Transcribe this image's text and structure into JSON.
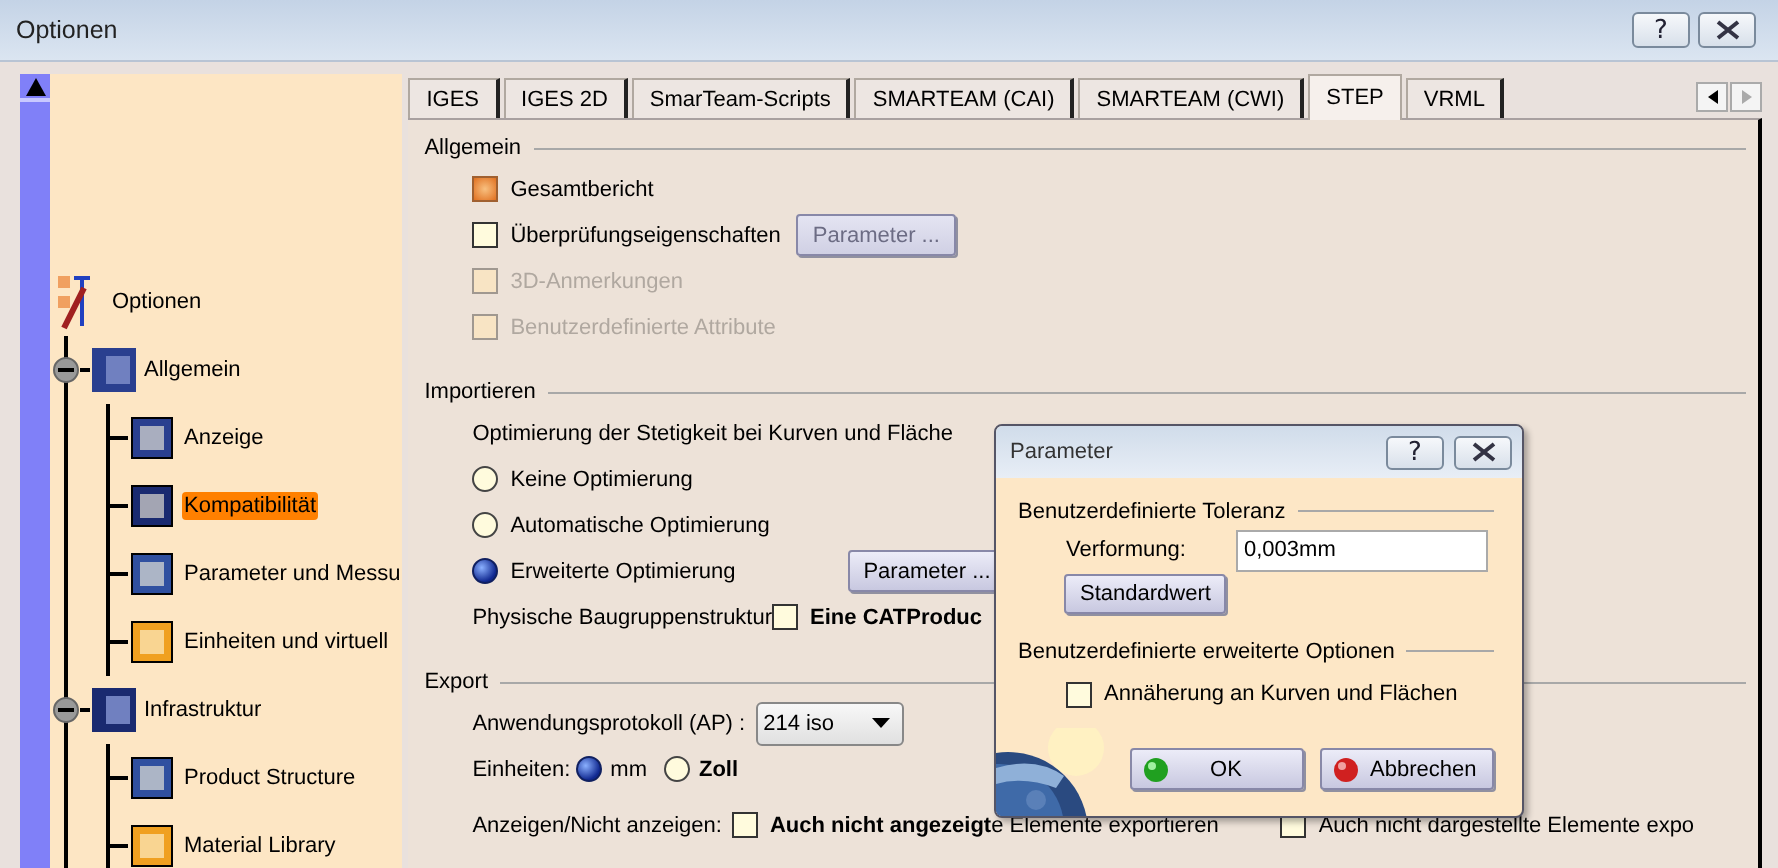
{
  "window": {
    "title": "Optionen",
    "help": "?"
  },
  "tree": [
    {
      "label": "Optionen",
      "selected": false,
      "children": [
        {
          "label": "Allgemein",
          "selected": false,
          "expanded": true,
          "children": [
            {
              "label": "Anzeige",
              "selected": false
            },
            {
              "label": "Kompatibilität",
              "selected": true
            },
            {
              "label": "Parameter und Messu",
              "selected": false
            },
            {
              "label": "Einheiten und virtuell",
              "selected": false
            }
          ]
        },
        {
          "label": "Infrastruktur",
          "selected": false,
          "expanded": true,
          "children": [
            {
              "label": "Product Structure",
              "selected": false
            },
            {
              "label": "Material Library",
              "selected": false
            }
          ]
        }
      ]
    }
  ],
  "tabs": [
    {
      "label": "IGES",
      "selected": false
    },
    {
      "label": "IGES 2D",
      "selected": false
    },
    {
      "label": "SmarTeam-Scripts",
      "selected": false
    },
    {
      "label": "SMARTEAM (CAI)",
      "selected": false
    },
    {
      "label": "SMARTEAM (CWI)",
      "selected": false
    },
    {
      "label": "STEP",
      "selected": true
    },
    {
      "label": "VRML",
      "selected": false
    }
  ],
  "general": {
    "title": "Allgemein",
    "options": [
      {
        "label": "Gesamtbericht",
        "checked": true,
        "disabled": false
      },
      {
        "label": "Überprüfungseigenschaften",
        "checked": false,
        "disabled": false,
        "button": {
          "label": "Parameter ...",
          "disabled": true
        }
      },
      {
        "label": "3D-Anmerkungen",
        "checked": false,
        "disabled": true
      },
      {
        "label": "Benutzerdefinierte Attribute",
        "checked": false,
        "disabled": true
      }
    ]
  },
  "import": {
    "title": "Importieren",
    "optimization_label": "Optimierung der Stetigkeit bei Kurven und Fläche",
    "radios": [
      {
        "label": "Keine Optimierung",
        "selected": false
      },
      {
        "label": "Automatische Optimierung",
        "selected": false
      },
      {
        "label": "Erweiterte Optimierung",
        "selected": true,
        "button": {
          "label": "Parameter ...",
          "disabled": false
        }
      }
    ],
    "structure_label": "Physische Baugruppenstruktur",
    "structure_option": {
      "label": "Eine CATProduc",
      "checked": false
    }
  },
  "export": {
    "title": "Export",
    "protocol_label": "Anwendungsprotokoll (AP) :",
    "protocol_value": "214 iso",
    "units_label": "Einheiten:",
    "units": [
      {
        "label": "mm",
        "selected": true
      },
      {
        "label": "Zoll",
        "selected": false
      }
    ],
    "show_label": "Anzeigen/Nicht anzeigen:",
    "show_options": [
      {
        "label": "**Auch nicht angezeigt**e Elemente exportieren",
        "checked": false
      },
      {
        "label": "Auch nicht dargestellte Elemente expo",
        "checked": false
      }
    ]
  },
  "dialog": {
    "title": "Parameter",
    "help": "?",
    "tolerance_title": "Benutzerdefinierte Toleranz",
    "deformation_label": "Verformung:",
    "deformation_value": "0,003mm",
    "default_button": "Standardwert",
    "options_title": "Benutzerdefinierte erweiterte Optionen",
    "approx": {
      "label": "Annäherung an Kurven und Flächen",
      "checked": false
    },
    "ok": "OK",
    "cancel": "Abbrechen"
  }
}
